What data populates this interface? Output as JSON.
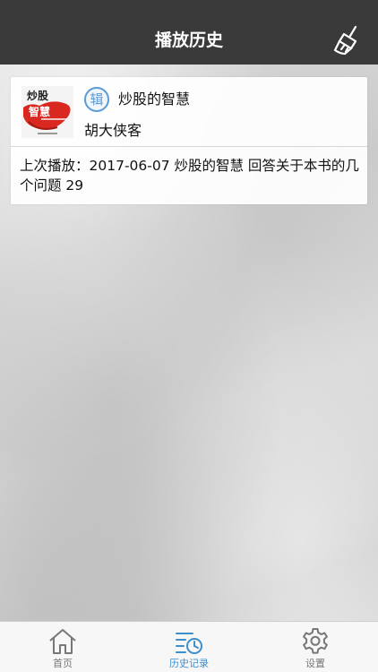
{
  "header": {
    "title": "播放历史",
    "clear_icon": "broom-clear-icon"
  },
  "history": [
    {
      "cover_text_line1": "炒股",
      "cover_text_line2": "智慧",
      "album_badge": "辑",
      "album_title": "炒股的智慧",
      "author": "胡大侠客",
      "last_play": "上次播放：2017-06-07  炒股的智慧 回答关于本书的几个问题 29"
    }
  ],
  "tabbar": {
    "active_color": "#3d8ecb",
    "items": [
      {
        "label": "首页",
        "icon": "home-icon"
      },
      {
        "label": "历史记录",
        "icon": "history-icon"
      },
      {
        "label": "设置",
        "icon": "settings-gear-icon"
      }
    ]
  }
}
